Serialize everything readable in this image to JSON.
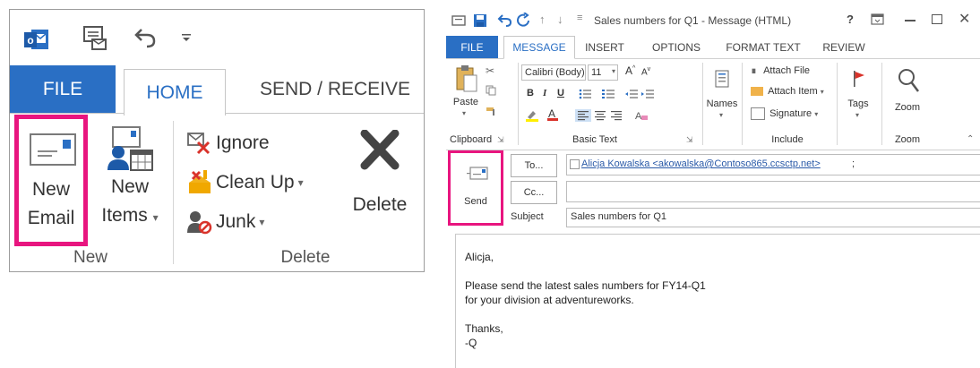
{
  "left": {
    "tabs": {
      "file": "FILE",
      "home": "HOME",
      "send_receive": "SEND / RECEIVE"
    },
    "new_group": {
      "new_email_line1": "New",
      "new_email_line2": "Email",
      "new_items_line1": "New",
      "new_items_line2": "Items",
      "label": "New"
    },
    "delete_group": {
      "ignore": "Ignore",
      "clean_up": "Clean Up",
      "junk": "Junk",
      "delete": "Delete",
      "label": "Delete"
    }
  },
  "right": {
    "window_title": "Sales numbers for Q1 - Message (HTML)",
    "help": "?",
    "tabs": [
      "FILE",
      "MESSAGE",
      "INSERT",
      "OPTIONS",
      "FORMAT TEXT",
      "REVIEW"
    ],
    "clipboard": {
      "paste": "Paste",
      "label": "Clipboard"
    },
    "basic_text": {
      "font": "Calibri (Body)",
      "size": "11",
      "bold": "B",
      "italic": "I",
      "underline": "U",
      "label": "Basic Text"
    },
    "names": {
      "label": "Names"
    },
    "include": {
      "attach_file": "Attach File",
      "attach_item": "Attach Item",
      "signature": "Signature",
      "label": "Include"
    },
    "tags": {
      "label": "Tags"
    },
    "zoom": {
      "button": "Zoom",
      "label": "Zoom"
    },
    "compose": {
      "send": "Send",
      "to_button": "To...",
      "cc_button": "Cc...",
      "subject_label": "Subject",
      "to_value": "Alicja Kowalska <akowalska@Contoso865.ccsctp.net>",
      "to_suffix": ";",
      "cc_value": "",
      "subject_value": "Sales numbers for Q1"
    },
    "body_lines": [
      "Alicja,",
      "",
      "Please send the latest sales numbers for FY14-Q1",
      "for your division at adventureworks.",
      "",
      "Thanks,",
      "-Q"
    ]
  },
  "colors": {
    "accent_blue": "#2a6fc4",
    "highlight_pink": "#e8157f",
    "flag_red": "#d9332b"
  }
}
